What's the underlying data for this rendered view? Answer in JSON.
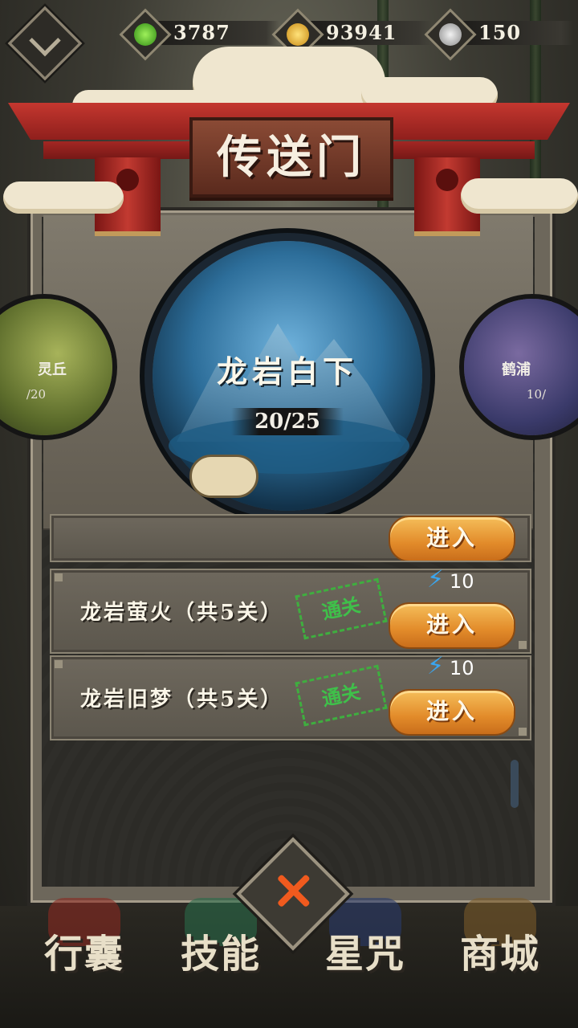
{
  "currency": {
    "jade": {
      "value": "3787",
      "icon": "jade-drop-icon",
      "color": "#56c12a"
    },
    "coin": {
      "value": "93941",
      "icon": "gold-coin-icon",
      "color": "#f0b028"
    },
    "silver": {
      "value": "150",
      "icon": "silver-swirl-icon",
      "color": "#c9c9c9"
    }
  },
  "title": "传送门",
  "portals": {
    "current": {
      "name": "龙岩白下",
      "progress": "20/25"
    },
    "left": {
      "name": "灵丘",
      "progress": "/20"
    },
    "right": {
      "name": "鹤浦",
      "progress": "10/"
    }
  },
  "stages": [
    {
      "name": "龙岩萤火（共5关）",
      "stamp": "通关",
      "cost": "10",
      "button": "进入"
    },
    {
      "name": "龙岩旧梦（共5关）",
      "stamp": "通关",
      "cost": "10",
      "button": "进入"
    }
  ],
  "partial_stage": {
    "button": "进入"
  },
  "nav": {
    "bag": "行囊",
    "skills": "技能",
    "stars": "星咒",
    "shop": "商城"
  }
}
